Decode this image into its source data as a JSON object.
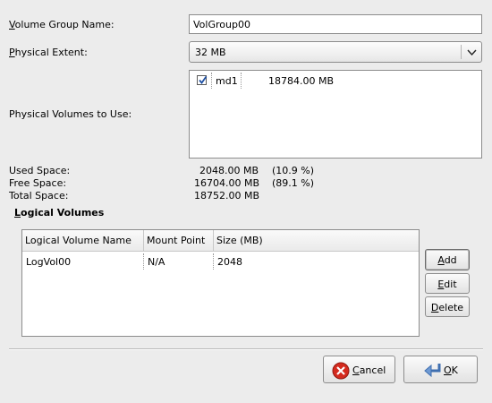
{
  "form": {
    "vg_name_label": "Volume Group Name:",
    "vg_name_value": "VolGroup00",
    "pe_label": "Physical Extent:",
    "pe_value": "32 MB",
    "pv_label": "Physical Volumes to Use:",
    "pv_list": [
      {
        "checked": true,
        "name": "md1",
        "size": "18784.00 MB"
      }
    ]
  },
  "space": {
    "used_label": "Used Space:",
    "used_value": "2048.00 MB",
    "used_pct": "(10.9 %)",
    "free_label": "Free Space:",
    "free_value": "16704.00 MB",
    "free_pct": "(89.1 %)",
    "total_label": "Total Space:",
    "total_value": "18752.00 MB"
  },
  "lv": {
    "section_label": "Logical Volumes",
    "columns": [
      "Logical Volume Name",
      "Mount Point",
      "Size (MB)"
    ],
    "rows": [
      {
        "name": "LogVol00",
        "mount": "N/A",
        "size": "2048"
      }
    ]
  },
  "buttons": {
    "add": "Add",
    "edit": "Edit",
    "delete": "Delete",
    "cancel": "Cancel",
    "ok": "OK"
  },
  "colors": {
    "dialog_bg": "#ececec",
    "cancel_icon": "#d42a1e",
    "ok_icon": "#6f9ad3"
  }
}
